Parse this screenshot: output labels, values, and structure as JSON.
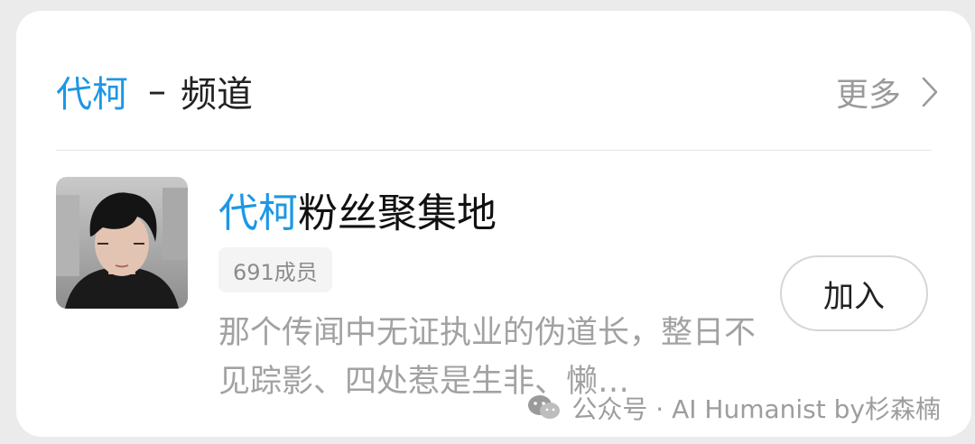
{
  "header": {
    "keyword": "代柯",
    "separator": "–",
    "title": "频道",
    "more_label": "更多",
    "more_icon": "chevron-right-icon"
  },
  "channel": {
    "avatar_icon": "channel-avatar-portrait",
    "name_keyword": "代柯",
    "name_rest": "粉丝聚集地",
    "member_count": "691成员",
    "description": "那个传闻中无证执业的伪道长，整日不见踪影、四处惹是生非、懒…",
    "join_label": "加入"
  },
  "watermark": {
    "icon": "wechat-icon",
    "text": "公众号 · AI Humanist by杉森楠"
  },
  "colors": {
    "accent": "#1d97e6",
    "muted_text": "#a2a2a2",
    "badge_bg": "#f4f4f4"
  }
}
